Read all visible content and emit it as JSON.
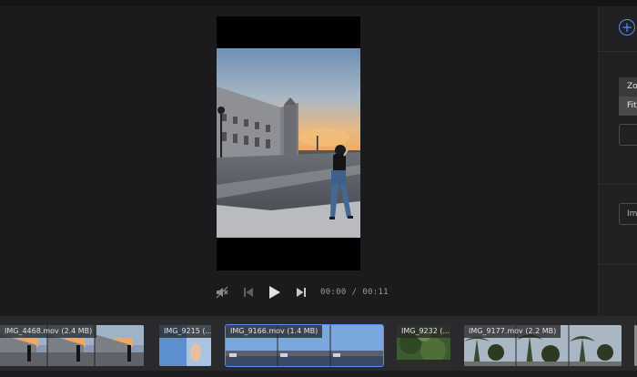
{
  "player": {
    "time_current": "00:00",
    "time_separator": "/",
    "time_total": "00:11"
  },
  "sidebar": {
    "menu_items": [
      "Zoom",
      "Fit"
    ],
    "menu_selected": 1,
    "box_1": "",
    "box_2": "Im"
  },
  "timeline": {
    "clips": [
      {
        "label": "IMG_4468.mov (2.4 MB)"
      },
      {
        "label": "IMG_9215 (..."
      },
      {
        "label": "IMG_9166.mov (1.4 MB)"
      },
      {
        "label": "IMG_9232 (..."
      },
      {
        "label": "IMG_9177.mov (2.2 MB)"
      }
    ]
  },
  "colors": {
    "accent": "#5a8cf0",
    "background": "#1b1b1d"
  }
}
